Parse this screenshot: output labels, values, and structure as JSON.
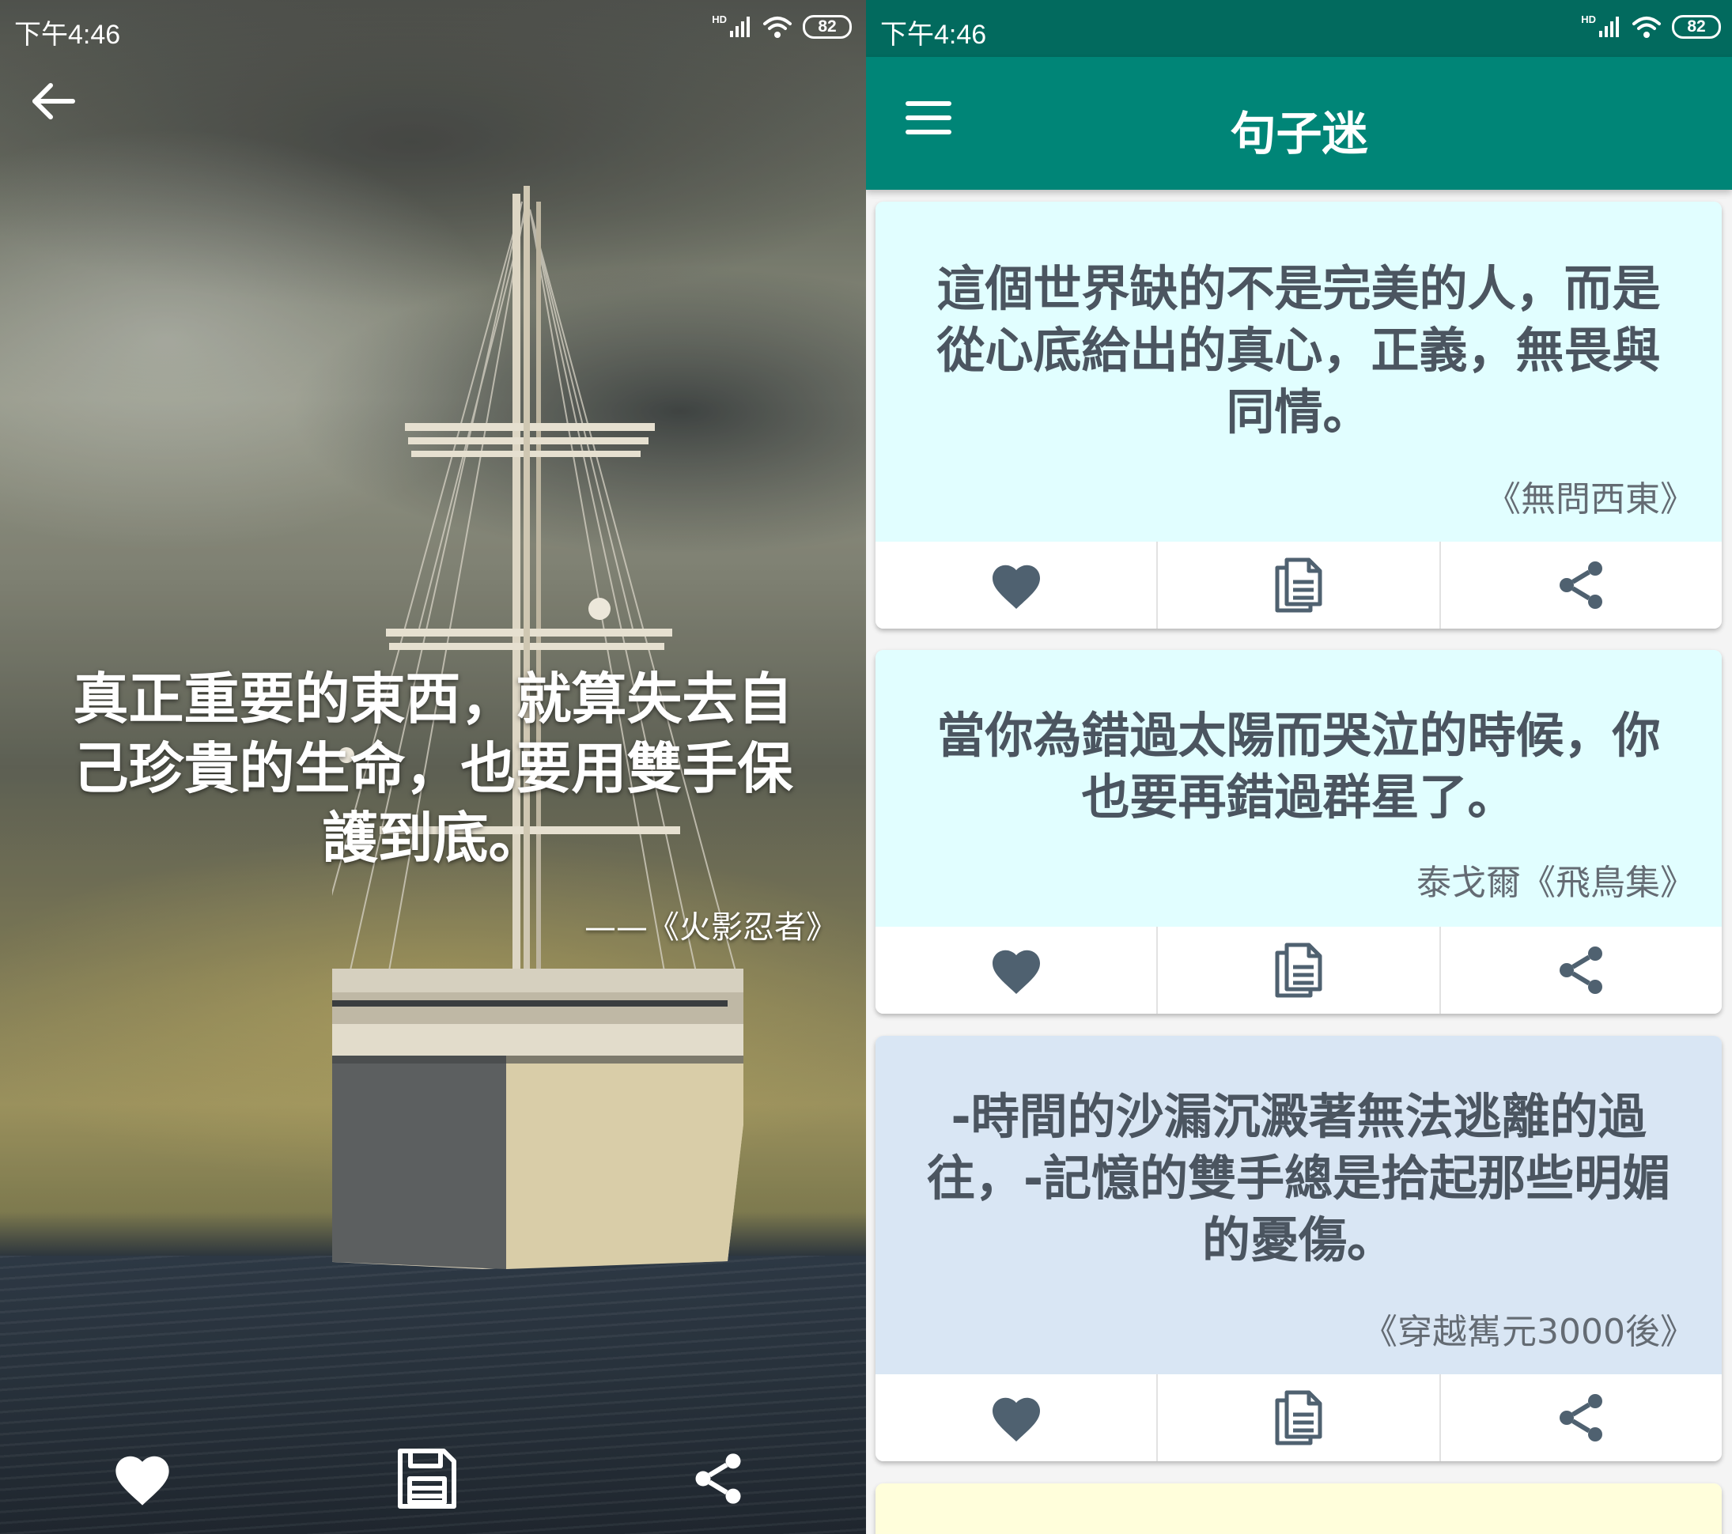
{
  "left_screen": {
    "status_bar": {
      "time": "下午4:46",
      "network": "HD",
      "battery": "82"
    },
    "quote": "真正重要的東西，就算失去自己珍貴的生命，也要用雙手保護到底。",
    "source": "——《火影忍者》",
    "actions": [
      "heart-icon",
      "save-icon",
      "share-icon"
    ]
  },
  "right_screen": {
    "status_bar": {
      "time": "下午4:46",
      "network": "HD",
      "battery": "82"
    },
    "app_title": "句子迷",
    "colors": {
      "appbar": "#008577",
      "statusbar": "#026a5e",
      "icon": "#4f6170"
    },
    "cards": [
      {
        "quote": "這個世界缺的不是完美的人，而是從心底給出的真心，正義，無畏與同情。",
        "source": "《無問西東》",
        "background": "#e1feff"
      },
      {
        "quote": "當你為錯過太陽而哭泣的時候，你也要再錯過群星了。",
        "source": "泰戈爾《飛鳥集》",
        "background": "#e1feff"
      },
      {
        "quote": "-時間的沙漏沉澱著無法逃離的過往，-記憶的雙手總是拾起那些明媚的憂傷。",
        "source": "《穿越嶲元3000後》",
        "background": "#d9e6f4"
      },
      {
        "quote": "",
        "source": "",
        "background": "#fffedb"
      }
    ]
  }
}
